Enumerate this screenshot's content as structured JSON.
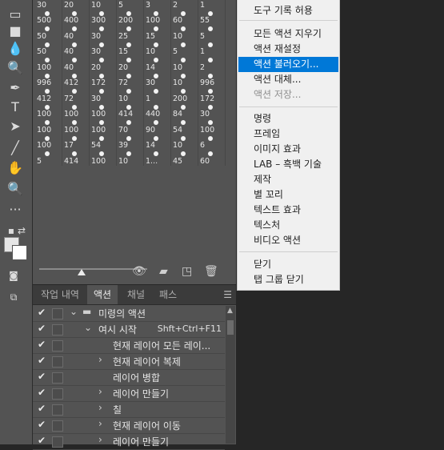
{
  "toolbar": {
    "tools": [
      {
        "icon": "eraser-icon",
        "glyph": "▭"
      },
      {
        "icon": "gradient-icon",
        "glyph": "■"
      },
      {
        "icon": "blur-icon",
        "glyph": "💧"
      },
      {
        "icon": "dodge-icon",
        "glyph": "🔍"
      },
      {
        "icon": "pen-icon",
        "glyph": "✒"
      },
      {
        "icon": "type-icon",
        "glyph": "T"
      },
      {
        "icon": "path-selection-icon",
        "glyph": "➤"
      },
      {
        "icon": "line-icon",
        "glyph": "╱"
      },
      {
        "icon": "hand-icon",
        "glyph": "✋"
      },
      {
        "icon": "zoom-icon",
        "glyph": "🔍"
      },
      {
        "icon": "more-tools-icon",
        "glyph": "···"
      }
    ],
    "extra": {
      "icon": "quick-mask-icon",
      "glyph": "◙"
    },
    "screen": {
      "icon": "screen-mode-icon",
      "glyph": "⧉"
    },
    "default_colors": {
      "icon": "default-colors-icon",
      "glyph": "▪"
    },
    "swap_colors": {
      "icon": "swap-colors-icon",
      "glyph": "⇄"
    }
  },
  "brushes": [
    [
      "30",
      "20",
      "10",
      "5",
      "3",
      "2",
      "1"
    ],
    [
      "500",
      "400",
      "300",
      "200",
      "100",
      "60",
      "55"
    ],
    [
      "50",
      "40",
      "30",
      "25",
      "15",
      "10",
      "5"
    ],
    [
      "50",
      "40",
      "30",
      "15",
      "10",
      "5",
      "1"
    ],
    [
      "100",
      "40",
      "20",
      "20",
      "14",
      "10",
      "2"
    ],
    [
      "996",
      "412",
      "172",
      "72",
      "30",
      "10",
      "996"
    ],
    [
      "412",
      "72",
      "30",
      "10",
      "1",
      "200",
      "172"
    ],
    [
      "100",
      "100",
      "100",
      "414",
      "440",
      "84",
      "30"
    ],
    [
      "100",
      "100",
      "100",
      "70",
      "90",
      "54",
      "100"
    ],
    [
      "100",
      "17",
      "54",
      "39",
      "14",
      "10",
      "6"
    ],
    [
      "5",
      "414",
      "100",
      "10",
      "1...",
      "45",
      "60"
    ]
  ],
  "panel_tabs": [
    "작업 내역",
    "액션",
    "채널",
    "패스"
  ],
  "actions": [
    {
      "label": "미령의 액션",
      "level": 0,
      "open": true,
      "folder": true
    },
    {
      "label": "여시 시작",
      "level": 1,
      "open": true,
      "shortcut": "Shft+Ctrl+F11"
    },
    {
      "label": "현재 레이어 모든 레이...",
      "level": 2,
      "open": null
    },
    {
      "label": "현재 레이어 복제",
      "level": 2,
      "open": false
    },
    {
      "label": "레이어 병합",
      "level": 2,
      "open": null
    },
    {
      "label": "레이어 만들기",
      "level": 2,
      "open": false
    },
    {
      "label": "칠",
      "level": 2,
      "open": false
    },
    {
      "label": "현재 레이어 이동",
      "level": 2,
      "open": false
    },
    {
      "label": "레이어 만들기",
      "level": 2,
      "open": false
    }
  ],
  "menu": {
    "top_item": "도구 기록 허용",
    "group1": [
      {
        "label": "모든 액션 지우기"
      },
      {
        "label": "액션 재설정"
      },
      {
        "label": "액션 불러오기...",
        "highlighted": true
      },
      {
        "label": "액션 대체..."
      },
      {
        "label": "액션 저장...",
        "disabled": true
      }
    ],
    "group2": [
      "명령",
      "프레임",
      "이미지 효과",
      "LAB – 흑백 기술",
      "제작",
      "별 꼬리",
      "텍스트 효과",
      "텍스처",
      "비디오 액션"
    ],
    "group3": [
      "닫기",
      "탭 그룹 닫기"
    ]
  },
  "colors": {
    "highlight": "#0078d7",
    "panel": "#535353",
    "menu_bg": "#f0f0f0"
  }
}
